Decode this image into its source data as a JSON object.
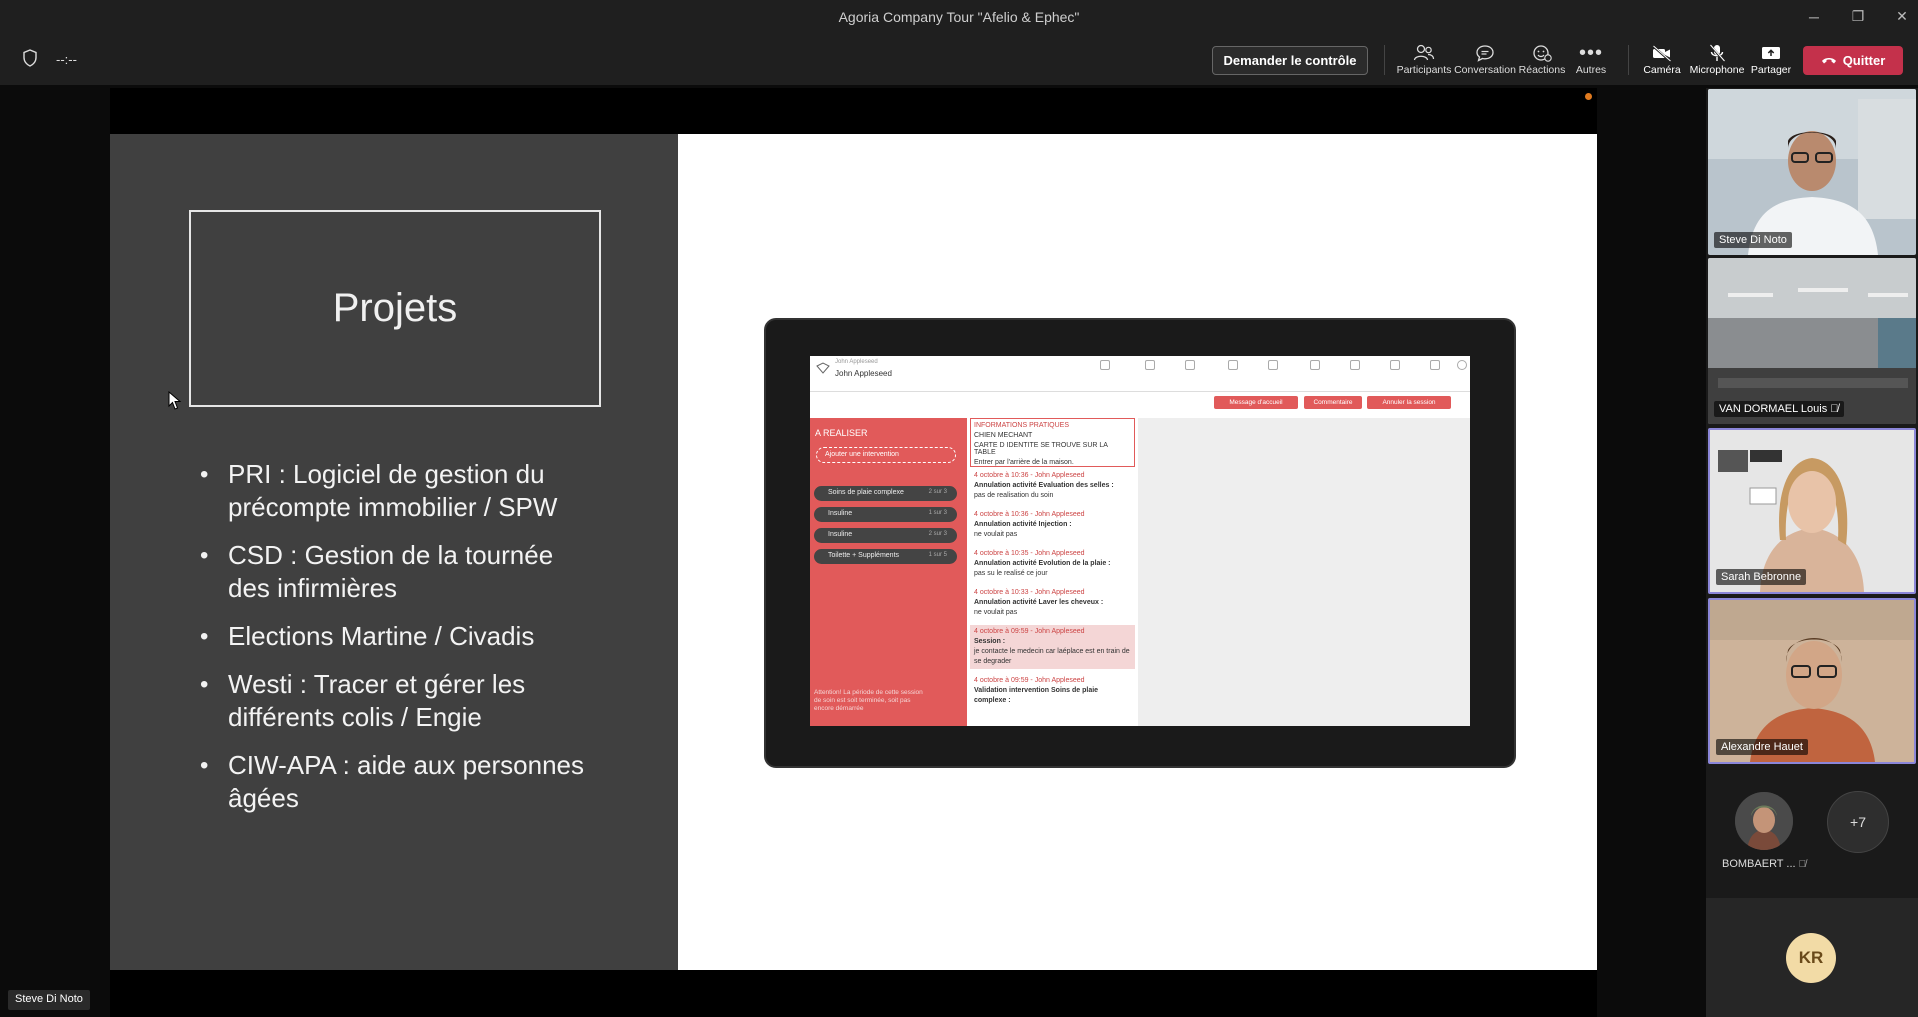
{
  "window": {
    "title": "Agoria Company Tour \"Afelio & Ephec\""
  },
  "toolbar": {
    "timer": "--:--",
    "request_control": "Demander le contrôle",
    "participants": "Participants",
    "conversation": "Conversation",
    "reactions": "Réactions",
    "more": "Autres",
    "camera": "Caméra",
    "microphone": "Microphone",
    "share": "Partager",
    "quit": "Quitter",
    "quit_color": "#c4314b"
  },
  "slide": {
    "title": "Projets",
    "bullets": [
      "PRI : Logiciel de gestion du précompte immobilier / SPW",
      "CSD : Gestion de la tournée des infirmières",
      "Elections Martine / Civadis",
      "Westi : Tracer et gérer les différents colis / Engie",
      "CIW-APA : aide aux personnes âgées"
    ]
  },
  "tablet_app": {
    "user_top": "John Appleseed",
    "user_name": "John Appleseed",
    "a_realiser": "A REALISER",
    "add_intervention": "Ajouter une intervention",
    "pills": [
      {
        "label": "Soins de plaie complexe",
        "count": "2 sur 3"
      },
      {
        "label": "Insuline",
        "count": "1 sur 3"
      },
      {
        "label": "Insuline",
        "count": "2 sur 3"
      },
      {
        "label": "Toilette + Suppléments",
        "count": "1 sur 5"
      }
    ],
    "note": "Attention! La période de cette session de soin est soit terminée, soit pas encore démarrée",
    "buttons": [
      "Message d'accueil",
      "Commentaire",
      "Annuler la session"
    ],
    "info_title": "INFORMATIONS PRATIQUES",
    "info_lines": [
      "CHIEN MECHANT",
      "CARTE D IDENTITE SE TROUVE SUR LA TABLE",
      "Entrer par l'arrière de la maison."
    ],
    "entries": [
      {
        "date": "4 octobre à 10:36 - John Appleseed",
        "title": "Annulation activité Evaluation des selles :",
        "text": "pas de realisation du soin",
        "highlight": false
      },
      {
        "date": "4 octobre à 10:36 - John Appleseed",
        "title": "Annulation activité Injection :",
        "text": "ne voulait pas",
        "highlight": false
      },
      {
        "date": "4 octobre à 10:35 - John Appleseed",
        "title": "Annulation activité Evolution de la plaie :",
        "text": "pas su le realisé ce jour",
        "highlight": false
      },
      {
        "date": "4 octobre à 10:33 - John Appleseed",
        "title": "Annulation activité Laver les cheveux :",
        "text": "ne voulait pas",
        "highlight": false
      },
      {
        "date": "4 octobre à 09:59 - John Appleseed",
        "title": "Session :",
        "text": "je contacte le medecin car laéplace est en train de se degrader",
        "highlight": true
      },
      {
        "date": "4 octobre à 09:59 - John Appleseed",
        "title": "Validation intervention Soins de plaie complexe :",
        "text": "",
        "highlight": false
      }
    ]
  },
  "presenter_label": "Steve Di Noto",
  "participants": [
    {
      "name": "Steve Di Noto",
      "muted": false,
      "active": false
    },
    {
      "name": "VAN DORMAEL Louis",
      "muted": true,
      "active": false
    },
    {
      "name": "Sarah Bebronne",
      "muted": false,
      "active": true
    },
    {
      "name": "Alexandre Hauet",
      "muted": false,
      "active": true
    }
  ],
  "small_participant": {
    "name": "BOMBAERT ...",
    "muted": true
  },
  "more_count": "+7",
  "kr_initials": "KR"
}
